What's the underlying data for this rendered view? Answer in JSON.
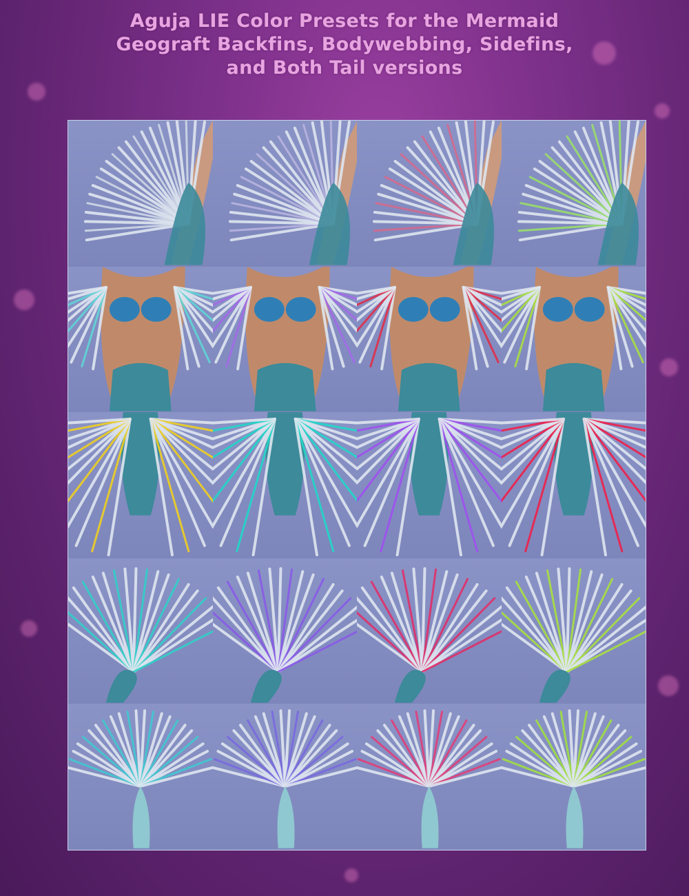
{
  "title": {
    "line1": "Aguja LIE Color Presets for the Mermaid",
    "line2": "Geograft Backfins, Bodywebbing, Sidefins,",
    "line3": "and Both Tail versions"
  },
  "colors": {
    "background": "#7a2f88",
    "title": "#e8a4e0",
    "panel": "#8088b8",
    "scales": "#3c8a9a"
  },
  "rows": [
    {
      "part": "backfins",
      "accents": [
        "#cfd8e6",
        "#b9b4e0",
        "#d46a8e",
        "#9adf6a"
      ]
    },
    {
      "part": "bodywebbing",
      "accents": [
        "#5fd6d6",
        "#a46ae8",
        "#e0304a",
        "#a8e040"
      ]
    },
    {
      "part": "sidefins",
      "accents": [
        "#f0d020",
        "#20d8c8",
        "#a050f0",
        "#f0204a"
      ]
    },
    {
      "part": "tail-version-1",
      "accents": [
        "#30d0c8",
        "#8a5ae8",
        "#e0306a",
        "#a8e040"
      ]
    },
    {
      "part": "tail-version-2",
      "accents": [
        "#40c8d0",
        "#7a6ae0",
        "#e0407a",
        "#a0e040"
      ]
    }
  ]
}
